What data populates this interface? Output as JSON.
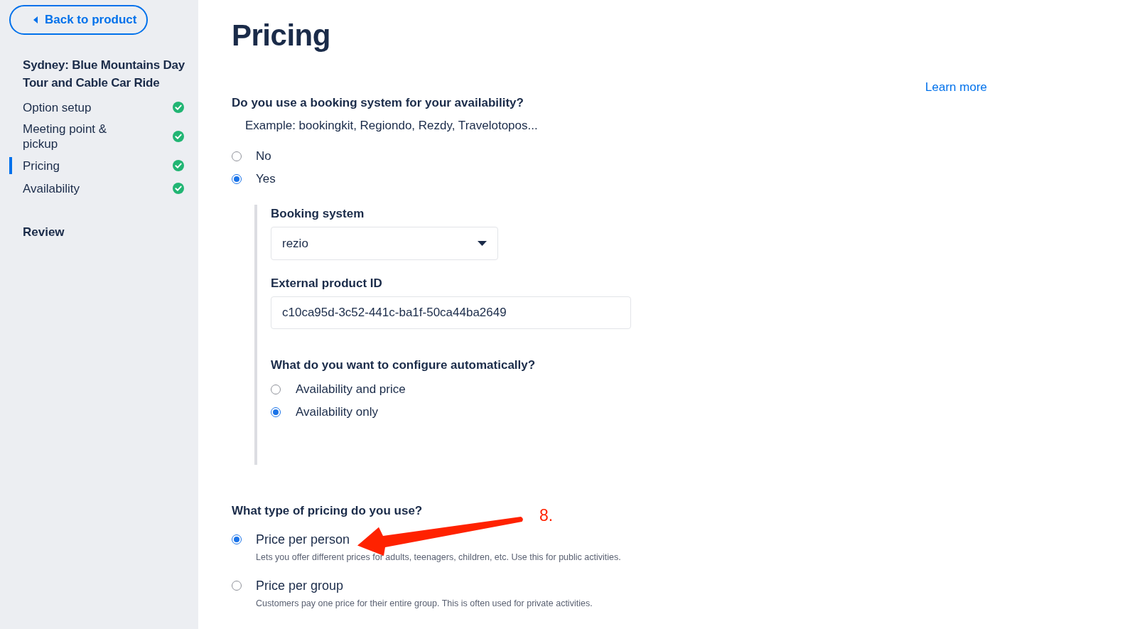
{
  "sidebar": {
    "back_button": {
      "label": "Back to product"
    },
    "product_title": "Sydney: Blue Mountains Day Tour and Cable Car Ride",
    "steps": [
      {
        "label": "Option setup",
        "selected": false,
        "completed": true
      },
      {
        "label": "Meeting point & pickup",
        "selected": false,
        "completed": true
      },
      {
        "label": "Pricing",
        "selected": true,
        "completed": true
      },
      {
        "label": "Availability",
        "selected": false,
        "completed": true
      }
    ],
    "review": {
      "label": "Review"
    }
  },
  "page": {
    "title": "Pricing",
    "learn_more": "Learn more",
    "booking_question": {
      "label": "Do you use a booking system for your availability?",
      "hint": "Example: bookingkit, Regiondo, Rezdy, Travelotopos...",
      "options": [
        {
          "label": "No",
          "selected": false
        },
        {
          "label": "Yes",
          "selected": true
        }
      ]
    },
    "booking_details": {
      "booking_system": {
        "label": "Booking system",
        "value": "rezio"
      },
      "external_product_id": {
        "label": "External product ID",
        "value": "c10ca95d-3c52-441c-ba1f-50ca44ba2649"
      },
      "configure": {
        "label": "What do you want to configure automatically?",
        "options": [
          {
            "label": "Availability and price",
            "selected": false
          },
          {
            "label": "Availability only",
            "selected": true
          }
        ]
      }
    },
    "pricing_type": {
      "label": "What type of pricing do you use?",
      "options": [
        {
          "label": "Price per person",
          "description": "Lets you offer different prices for adults, teenagers, children, etc. Use this for public activities.",
          "selected": true
        },
        {
          "label": "Price per group",
          "description": "Customers pay one price for their entire group. This is often used for private activities.",
          "selected": false
        }
      ]
    }
  },
  "annotation": {
    "label": "8."
  }
}
